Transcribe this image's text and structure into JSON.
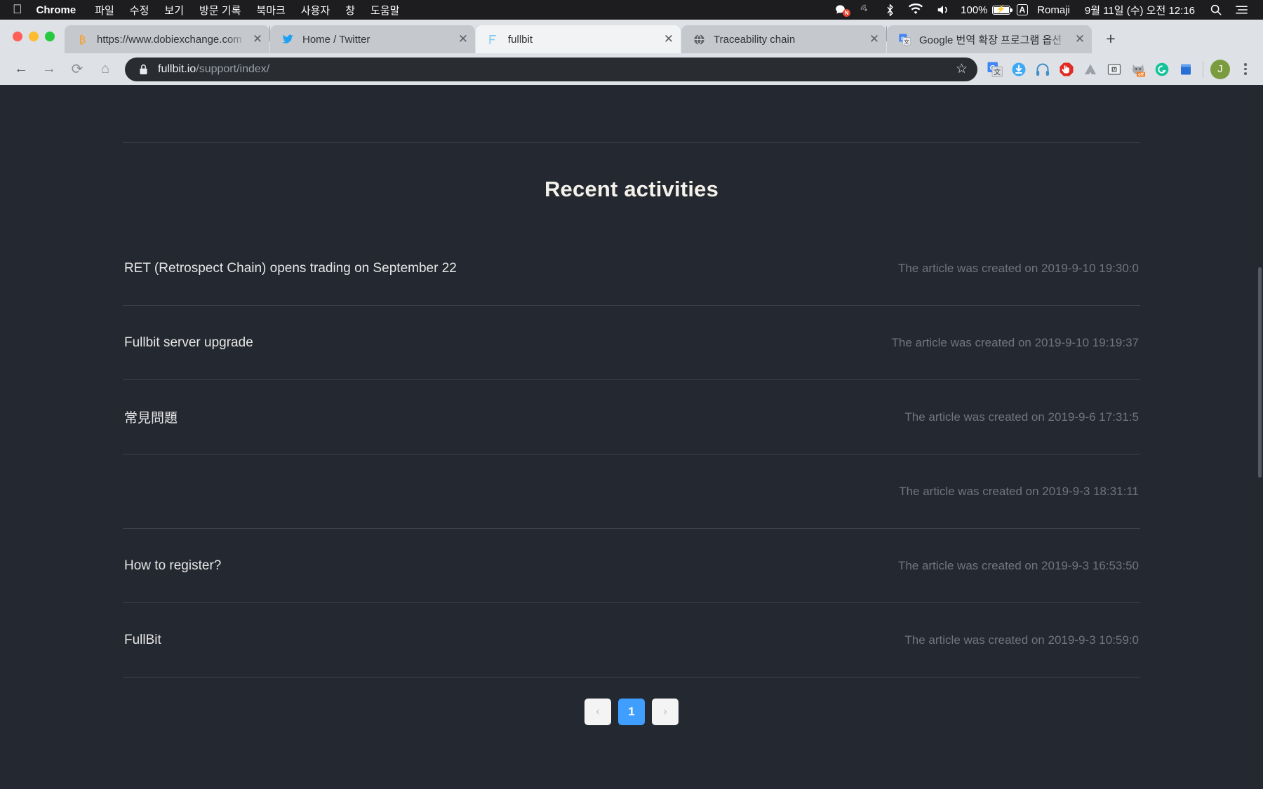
{
  "menubar": {
    "apple_icon": "apple-logo",
    "app_name": "Chrome",
    "items": [
      "파일",
      "수정",
      "보기",
      "방문 기록",
      "북마크",
      "사용자",
      "창",
      "도움말"
    ],
    "status": {
      "notification_badge": "N",
      "battery_percent": "100%",
      "input_source_badge": "A",
      "input_source": "Romaji",
      "datetime": "9월 11일 (수) 오전 12:16"
    }
  },
  "browser": {
    "tabs": [
      {
        "title": "https://www.dobiexchange.com",
        "favicon": "bitcoin-icon",
        "active": false
      },
      {
        "title": "Home / Twitter",
        "favicon": "twitter-icon",
        "active": false
      },
      {
        "title": "fullbit",
        "favicon": "fullbit-icon",
        "active": true
      },
      {
        "title": "Traceability chain",
        "favicon": "globe-icon",
        "active": false
      },
      {
        "title": "Google 번역 확장 프로그램 옵션",
        "favicon": "google-translate-icon",
        "active": false
      }
    ],
    "new_tab_label": "+",
    "close_label": "✕",
    "toolbar": {
      "back_label": "←",
      "forward_label": "→",
      "reload_label": "⟳",
      "home_label": "⌂",
      "url_host": "fullbit.io",
      "url_path": "/support/index/",
      "star_label": "☆",
      "profile_initial": "J",
      "extensions": [
        "google-translate-icon",
        "download-icon",
        "headphones-icon",
        "adblock-stop-icon",
        "drive-icon",
        "notebook-icon",
        "wolf-off-icon",
        "grammarly-icon",
        "clipboard-icon"
      ]
    }
  },
  "page": {
    "title": "Recent activities",
    "date_prefix": "The article was created on",
    "rows": [
      {
        "title": "RET (Retrospect Chain) opens trading on September 22",
        "date": "The article was created on 2019-9-10 19:30:0"
      },
      {
        "title": "Fullbit server upgrade",
        "date": "The article was created on 2019-9-10 19:19:37"
      },
      {
        "title": "常見問題",
        "date": "The article was created on 2019-9-6 17:31:5"
      },
      {
        "title": "",
        "date": "The article was created on 2019-9-3 18:31:11"
      },
      {
        "title": "How to register?",
        "date": "The article was created on 2019-9-3 16:53:50"
      },
      {
        "title": "FullBit",
        "date": "The article was created on 2019-9-3 10:59:0"
      }
    ],
    "pagination": {
      "prev_label": "‹",
      "current_page": "1",
      "next_label": "›",
      "active_color": "#409eff"
    }
  }
}
